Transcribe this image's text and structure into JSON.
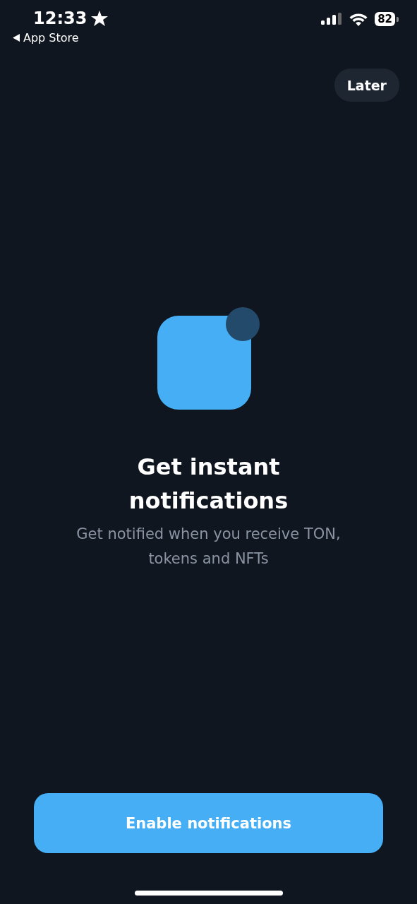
{
  "status_bar": {
    "time": "12:33",
    "back_label": "App Store",
    "battery": "82"
  },
  "later_button": "Later",
  "title": "Get instant notifications",
  "subtitle": "Get notified when you receive TON, tokens and NFTs",
  "primary_button": "Enable notifications"
}
